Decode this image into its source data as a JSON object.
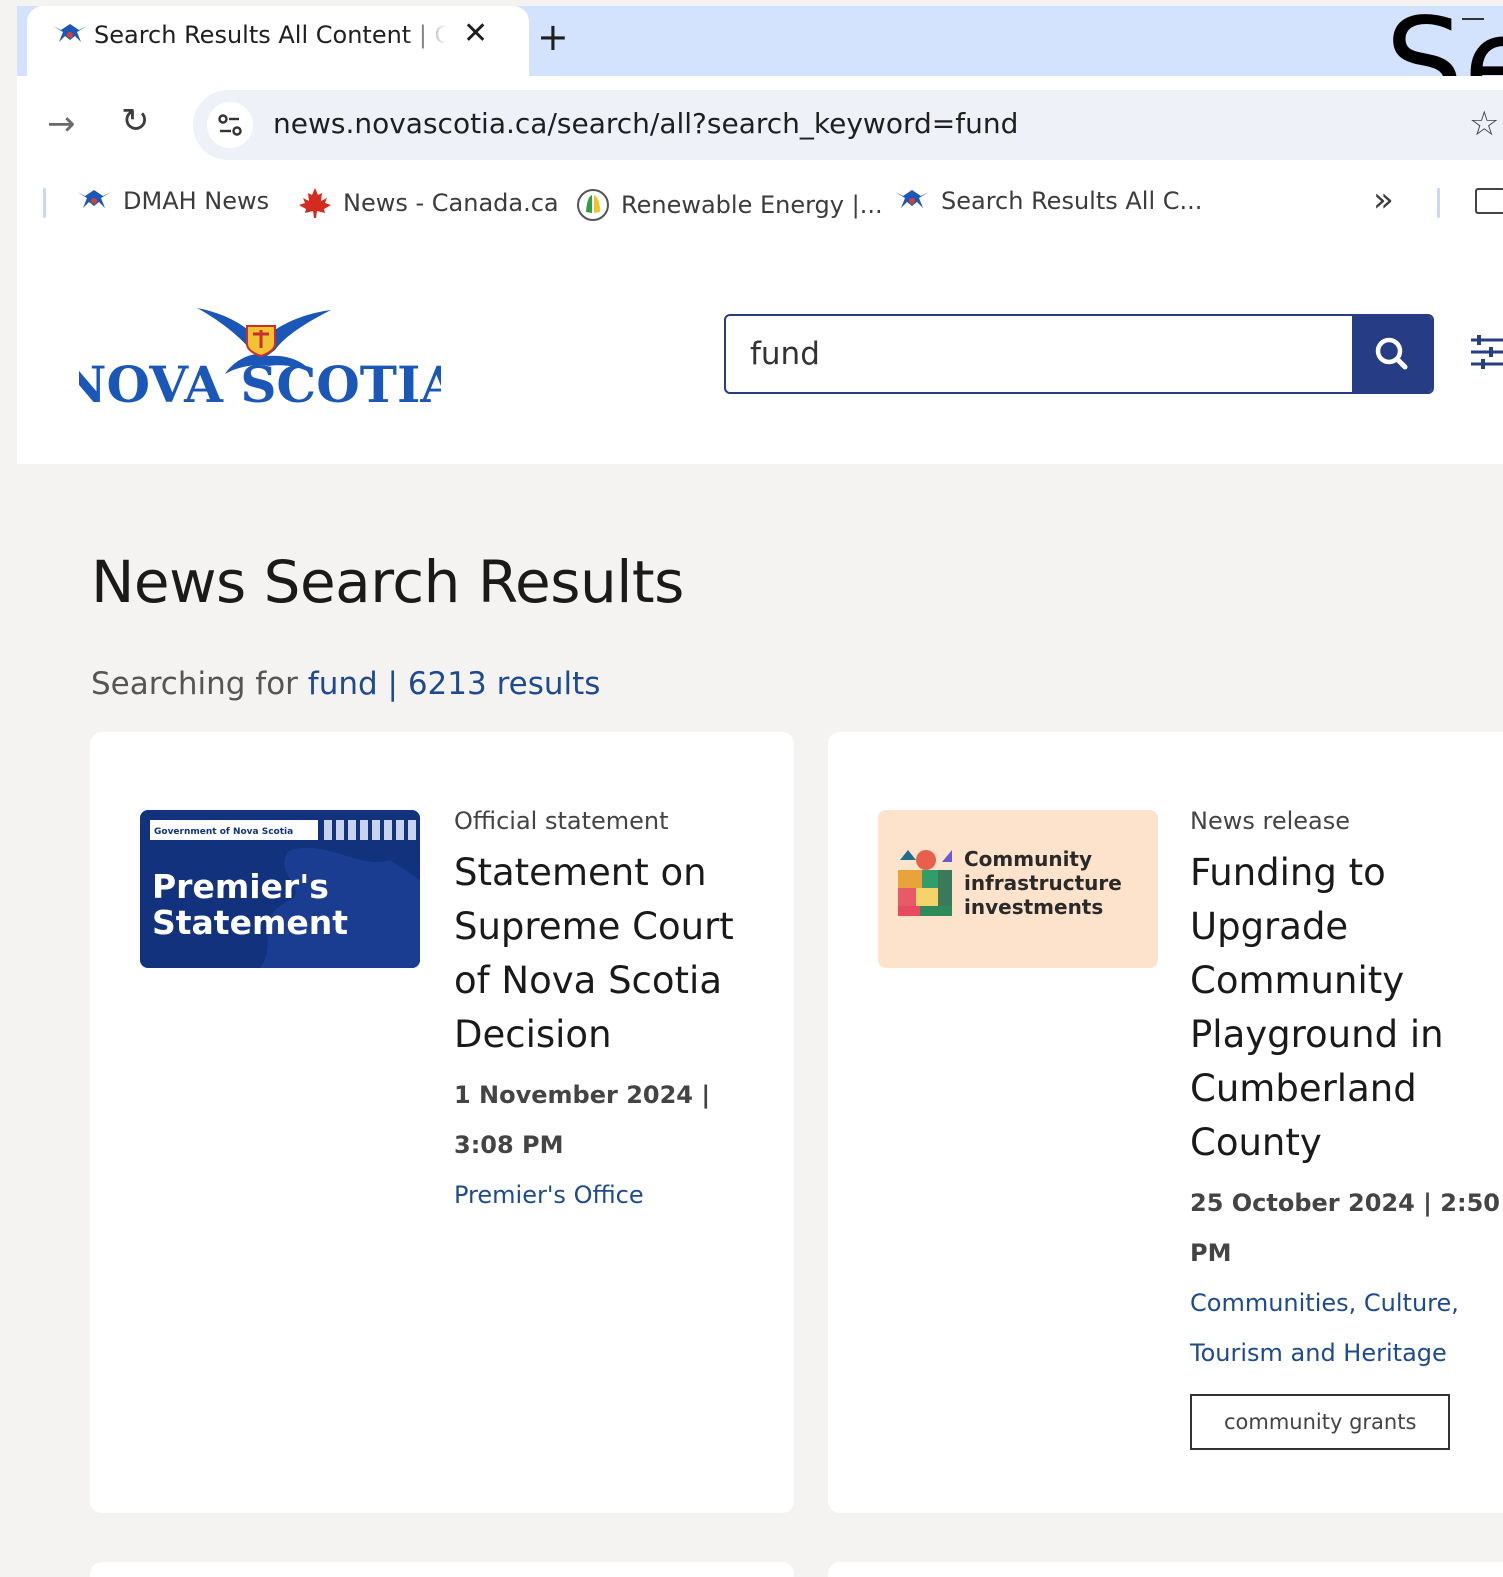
{
  "browser": {
    "tab_title": "Search Results All Content | Government of Nova Scotia",
    "url": "news.novascotia.ca/search/all?search_keyword=fund",
    "bookmarks": [
      {
        "label": "DMAH News",
        "icon": "nova-scotia-icon"
      },
      {
        "label": "News - Canada.ca",
        "icon": "maple-leaf-icon"
      },
      {
        "label": "Renewable Energy |...",
        "icon": "renewable-energy-icon"
      },
      {
        "label": "Search Results All C...",
        "icon": "nova-scotia-icon"
      }
    ],
    "overlay_text": "Se"
  },
  "header": {
    "logo_text": "NOVA SCOTIA",
    "search_value": "fund"
  },
  "main": {
    "page_title": "News Search Results",
    "summary_prefix": "Searching for ",
    "summary_keyword": "fund",
    "summary_separator": " | ",
    "summary_count": "6213 results"
  },
  "results": [
    {
      "thumb_small": "Government of Nova Scotia",
      "thumb_line1": "Premier's",
      "thumb_line2": "Statement",
      "type": "Official statement",
      "title": "Statement on Supreme Court of Nova Scotia Decision",
      "date": "1 November 2024 | 3:08 PM",
      "department": "Premier's Office"
    },
    {
      "thumb_line1": "Community",
      "thumb_line2": "infrastructure",
      "thumb_line3": "investments",
      "type": "News release",
      "title": "Funding to Upgrade Community Playground in Cumberland County",
      "date": "25 October 2024 | 2:50 PM",
      "department": "Communities, Culture, Tourism and Heritage",
      "tag": "community grants"
    }
  ],
  "colors": {
    "brand_blue": "#263d85",
    "link_blue": "#1e4b8f",
    "tab_strip": "#d3e3fd",
    "page_bg": "#f5f3f1"
  }
}
